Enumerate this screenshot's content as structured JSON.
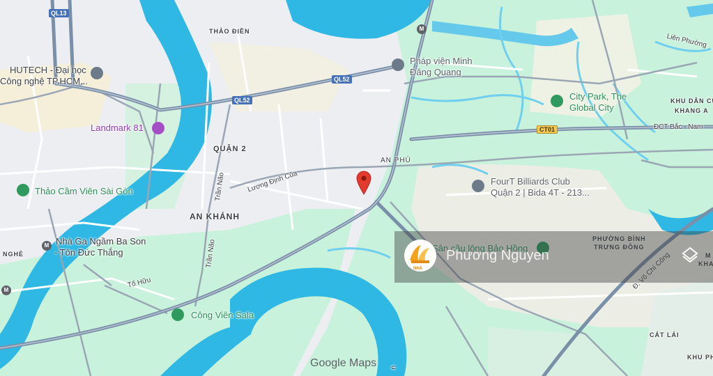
{
  "map": {
    "area_labels": {
      "thao_dien": "THẢO ĐIỀN",
      "quan2": "QUẬN 2",
      "an_khanh": "AN KHÁNH",
      "khu_dan_cu_1": "KHU DÂN CƯ",
      "khu_dan_cu_2": "KHANG A",
      "phuong_binh_1": "PHƯỜNG BÌNH",
      "phuong_binh_2": "TRƯNG ĐÔNG",
      "cat_lai": "CÁT LÁI",
      "khu_pho": "KHU PHI",
      "m_kha_1": "M",
      "m_kha_2": "KHA",
      "nghe": "NGHÈ"
    },
    "poi": {
      "hutech_1": "HUTECH - Đại học",
      "hutech_2": "Công nghệ TP.HCM...",
      "landmark81": "Landmark 81",
      "thao_cam_vien": "Thảo Cầm Viên Sài Gòn",
      "nha_ga_1": "Nhà Ga Ngầm Ba Son",
      "nha_ga_2": "- Tôn Đức Thắng",
      "cong_vien_sala": "Công Viên Sala",
      "phap_vien_1": "Pháp viện Minh",
      "phap_vien_2": "Đăng Quang",
      "city_park_1": "City Park, The",
      "city_park_2": "Global City",
      "fourt_1": "FourT Billiards Club",
      "fourt_2": "Quận 2 | Bida 4T - 213...",
      "san_cau_long": "Sân cầu lông Bảo Hồng"
    },
    "roads": {
      "an_phu": "AN PHÚ",
      "luong_dinh_cua": "Lương Định Của",
      "tran_nao_1": "Trần Não",
      "tran_nao_2": "Trần Não",
      "to_huu": "Tố Hữu",
      "lien_phuong": "Liên Phường",
      "dct_bac_nam": "ĐCT Bắc - Nam",
      "vo_chi_cong": "Đ. Võ Chí Công",
      "ugn": "ụ"
    },
    "shields": {
      "ql13": "QL13",
      "ql52_a": "QL52",
      "ql52_b": "QL52",
      "ct01": "CT01"
    },
    "metro_label": "M",
    "watermark_text": "Phương Nguyen",
    "watermark_logo_text": "NHÀ",
    "google_logo": "Google Maps",
    "colors": {
      "water": "#2fb8e3",
      "park": "#c4f0d6",
      "urban": "#eceef1",
      "highway": "#7a8fa8",
      "pin": "#e23b2e"
    }
  }
}
